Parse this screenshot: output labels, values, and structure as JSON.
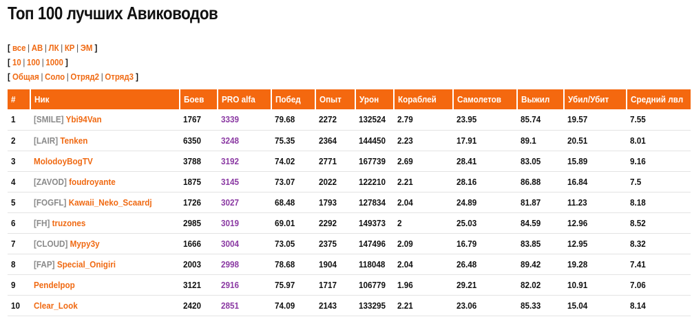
{
  "page": {
    "title": "Топ 100 лучших Авиководов"
  },
  "filters": {
    "rows": [
      [
        "все",
        "АВ",
        "ЛК",
        "КР",
        "ЭМ"
      ],
      [
        "10",
        "100",
        "1000"
      ],
      [
        "Общая",
        "Соло",
        "Отряд2",
        "Отряд3"
      ]
    ]
  },
  "table": {
    "headers": [
      "#",
      "Ник",
      "Боев",
      "PRO alfa",
      "Побед",
      "Опыт",
      "Урон",
      "Кораблей",
      "Самолетов",
      "Выжил",
      "Убил/Убит",
      "Средний лвл"
    ],
    "rows": [
      {
        "rank": "1",
        "clan": "[SMILE]",
        "nick": "Ybi94Van",
        "battles": "1767",
        "pro": "3339",
        "wins": "79.68",
        "exp": "2272",
        "damage": "132524",
        "ships": "2.79",
        "planes": "23.95",
        "survived": "85.74",
        "kd": "19.57",
        "avg_lvl": "7.55"
      },
      {
        "rank": "2",
        "clan": "[LAIR]",
        "nick": "Tenken",
        "battles": "6350",
        "pro": "3248",
        "wins": "75.35",
        "exp": "2364",
        "damage": "144450",
        "ships": "2.23",
        "planes": "17.91",
        "survived": "89.1",
        "kd": "20.51",
        "avg_lvl": "8.01"
      },
      {
        "rank": "3",
        "clan": "",
        "nick": "MolodoyBogTV",
        "battles": "3788",
        "pro": "3192",
        "wins": "74.02",
        "exp": "2771",
        "damage": "167739",
        "ships": "2.69",
        "planes": "28.41",
        "survived": "83.05",
        "kd": "15.89",
        "avg_lvl": "9.16"
      },
      {
        "rank": "4",
        "clan": "[ZAVOD]",
        "nick": "foudroyante",
        "battles": "1875",
        "pro": "3145",
        "wins": "73.07",
        "exp": "2022",
        "damage": "122210",
        "ships": "2.21",
        "planes": "28.16",
        "survived": "86.88",
        "kd": "16.84",
        "avg_lvl": "7.5"
      },
      {
        "rank": "5",
        "clan": "[FOGFL]",
        "nick": "Kawaii_Neko_Scaardj",
        "battles": "1726",
        "pro": "3027",
        "wins": "68.48",
        "exp": "1793",
        "damage": "127834",
        "ships": "2.04",
        "planes": "24.89",
        "survived": "81.87",
        "kd": "11.23",
        "avg_lvl": "8.18"
      },
      {
        "rank": "6",
        "clan": "[FH]",
        "nick": "truzones",
        "battles": "2985",
        "pro": "3019",
        "wins": "69.01",
        "exp": "2292",
        "damage": "149373",
        "ships": "2",
        "planes": "25.03",
        "survived": "84.59",
        "kd": "12.96",
        "avg_lvl": "8.52"
      },
      {
        "rank": "7",
        "clan": "[CLOUD]",
        "nick": "Mypy3y",
        "battles": "1666",
        "pro": "3004",
        "wins": "73.05",
        "exp": "2375",
        "damage": "147496",
        "ships": "2.09",
        "planes": "16.79",
        "survived": "83.85",
        "kd": "12.95",
        "avg_lvl": "8.32"
      },
      {
        "rank": "8",
        "clan": "[FAP]",
        "nick": "Special_Onigiri",
        "battles": "2003",
        "pro": "2998",
        "wins": "78.68",
        "exp": "1904",
        "damage": "118048",
        "ships": "2.04",
        "planes": "26.48",
        "survived": "89.42",
        "kd": "19.28",
        "avg_lvl": "7.41"
      },
      {
        "rank": "9",
        "clan": "",
        "nick": "Pendelpop",
        "battles": "3121",
        "pro": "2916",
        "wins": "75.97",
        "exp": "1717",
        "damage": "106779",
        "ships": "1.96",
        "planes": "29.21",
        "survived": "82.02",
        "kd": "10.91",
        "avg_lvl": "7.06"
      },
      {
        "rank": "10",
        "clan": "",
        "nick": "Clear_Look",
        "battles": "2420",
        "pro": "2851",
        "wins": "74.09",
        "exp": "2143",
        "damage": "133295",
        "ships": "2.21",
        "planes": "23.06",
        "survived": "85.33",
        "kd": "15.04",
        "avg_lvl": "8.14"
      }
    ]
  },
  "colors": {
    "accent": "#f4680f",
    "link": "#f06a13",
    "pro": "#8b3aa3",
    "clan": "#8a8a8a"
  }
}
